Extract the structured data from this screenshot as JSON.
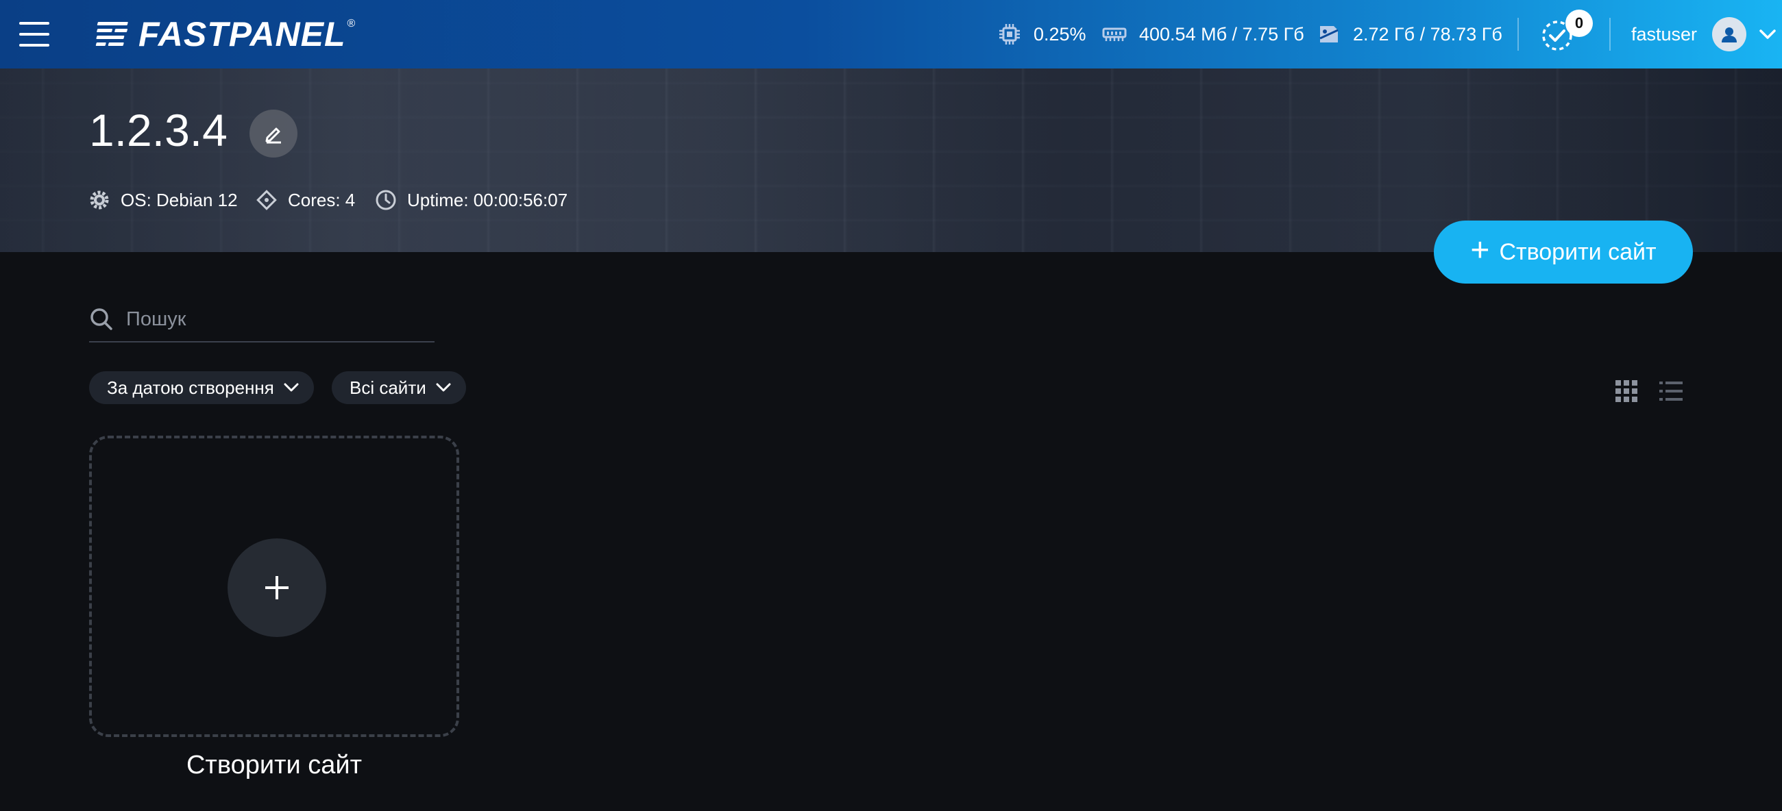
{
  "header": {
    "logo_text": "FASTPANEL",
    "logo_reg": "®",
    "cpu": "0.25%",
    "ram": "400.54 Мб / 7.75 Гб",
    "disk": "2.72 Гб / 78.73 Гб",
    "tasks_count": "0",
    "username": "fastuser"
  },
  "server": {
    "title": "1.2.3.4",
    "os": "OS: Debian 12",
    "cores": "Cores: 4",
    "uptime": "Uptime: 00:00:56:07"
  },
  "actions": {
    "create_site": "Створити сайт",
    "plus": "+"
  },
  "search": {
    "placeholder": "Пошук"
  },
  "filters": {
    "sort": "За датою створення",
    "scope": "Всі сайти"
  },
  "new_card": {
    "label": "Створити сайт"
  },
  "colors": {
    "accent": "#18b3f2",
    "background": "#0e1014",
    "chip": "#20252e"
  }
}
